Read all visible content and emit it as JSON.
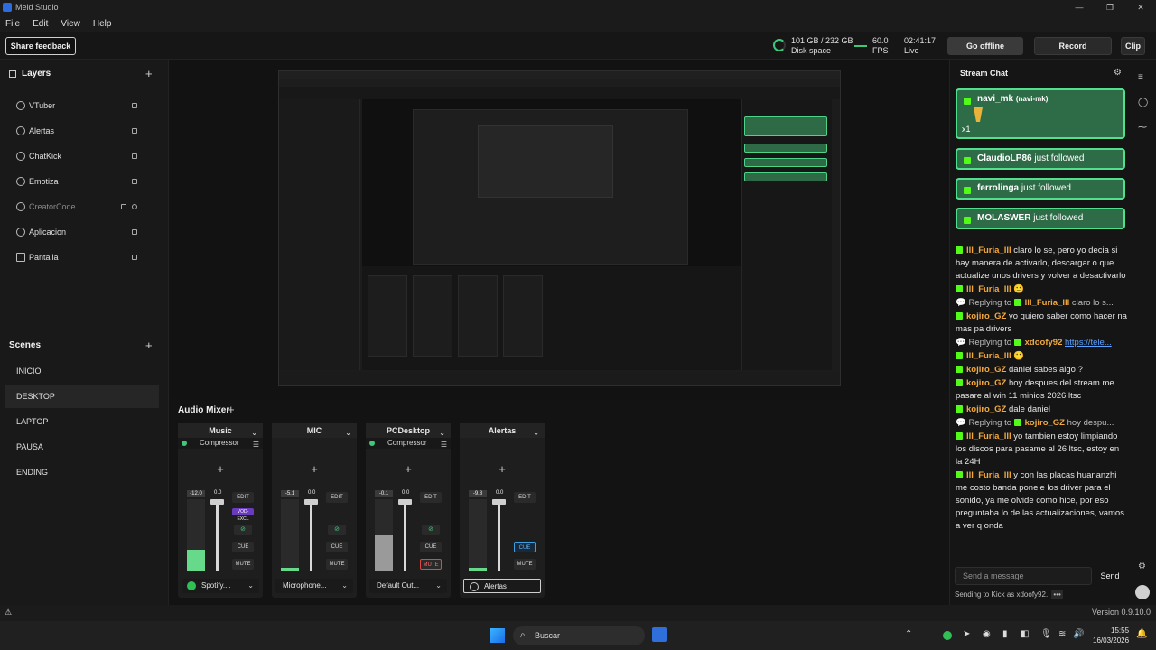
{
  "window": {
    "title": "Meld Studio",
    "buttons": [
      "—",
      "❐",
      "✕"
    ]
  },
  "menu": [
    "File",
    "Edit",
    "View",
    "Help"
  ],
  "toolbar": {
    "share_feedback": "Share feedback",
    "disk_value": "101 GB / 232 GB",
    "disk_label": "Disk space",
    "fps_value": "60.0",
    "fps_label": "FPS",
    "live_time": "02:41:17",
    "live_label": "Live",
    "go_offline": "Go offline",
    "record": "Record",
    "clip": "Clip"
  },
  "layers": {
    "title": "Layers",
    "items": [
      {
        "label": "VTuber",
        "dim": false
      },
      {
        "label": "Alertas",
        "dim": false
      },
      {
        "label": "ChatKick",
        "dim": false
      },
      {
        "label": "Emotiza",
        "dim": false
      },
      {
        "label": "CreatorCode",
        "dim": true
      },
      {
        "label": "Aplicacion",
        "dim": false
      },
      {
        "label": "Pantalla",
        "dim": false
      }
    ]
  },
  "scenes": {
    "title": "Scenes",
    "items": [
      "INICIO",
      "DESKTOP",
      "LAPTOP",
      "PAUSA",
      "ENDING"
    ],
    "active": "DESKTOP"
  },
  "mixer": {
    "title": "Audio Mixer",
    "strips": [
      {
        "name": "Music",
        "fx": "Compressor",
        "db": "-12.0",
        "gain": "0.0",
        "source": "Spotify....",
        "tag": "VOD-EXCL",
        "mute_state": "normal",
        "cue_state": "normal",
        "meter": 0.3,
        "meter_color": "#66d98a"
      },
      {
        "name": "MIC",
        "fx": "",
        "db": "-5.1",
        "gain": "0.0",
        "source": "Microphone...",
        "tag": "",
        "mute_state": "normal",
        "cue_state": "normal",
        "meter": 0.05,
        "meter_color": "#66d98a"
      },
      {
        "name": "PCDesktop",
        "fx": "Compressor",
        "db": "-0.1",
        "gain": "0.0",
        "source": "Default Out...",
        "tag": "",
        "mute_state": "red",
        "cue_state": "normal",
        "meter": 0.5,
        "meter_color": "#9a9a9a"
      },
      {
        "name": "Alertas",
        "fx": "",
        "db": "-9.8",
        "gain": "0.0",
        "source": "Alertas",
        "tag": "",
        "mute_state": "normal",
        "cue_state": "blue",
        "meter": 0.05,
        "meter_color": "#66d98a"
      }
    ],
    "labels": {
      "edit": "EDIT",
      "cue": "CUE",
      "mute": "MUTE",
      "link": "⊘"
    }
  },
  "chat": {
    "title": "Stream Chat",
    "highlight": {
      "user": "navi_mk",
      "handle": "(navi-mk)",
      "count": "x1"
    },
    "follows": [
      {
        "user": "ClaudioLP86",
        "text": "just followed"
      },
      {
        "user": "ferrolinga",
        "text": "just followed"
      },
      {
        "user": "MOLASWER",
        "text": "just followed"
      }
    ],
    "messages": [
      {
        "type": "msg",
        "user": "lll_Furia_lll",
        "text": "claro lo se, pero yo decia si hay manera de activarlo, descargar o que actualize unos drivers y volver a desactivarlo"
      },
      {
        "type": "msg",
        "user": "lll_Furia_lll",
        "text": "🙂"
      },
      {
        "type": "reply",
        "prefix": "Replying to",
        "user": "lll_Furia_lll",
        "text": "claro lo s..."
      },
      {
        "type": "msg",
        "user": "kojiro_GZ",
        "text": "yo quiero saber como hacer na mas pa drivers"
      },
      {
        "type": "reply",
        "prefix": "Replying to",
        "user": "xdoofy92",
        "text": "https://tele...",
        "link": true
      },
      {
        "type": "msg",
        "user": "lll_Furia_lll",
        "text": "🙂"
      },
      {
        "type": "msg",
        "user": "kojiro_GZ",
        "text": "daniel sabes algo ?"
      },
      {
        "type": "msg",
        "user": "kojiro_GZ",
        "text": "hoy despues del stream me pasare al win 11 minios 2026 ltsc"
      },
      {
        "type": "msg",
        "user": "kojiro_GZ",
        "text": "dale daniel"
      },
      {
        "type": "reply",
        "prefix": "Replying to",
        "user": "kojiro_GZ",
        "text": "hoy despu..."
      },
      {
        "type": "msg",
        "user": "lll_Furia_lll",
        "text": "yo tambien estoy limpiando los discos para pasame al 26 ltsc, estoy en la 24H"
      },
      {
        "type": "msg",
        "user": "lll_Furia_lll",
        "text": "y con las placas huananzhi me costo banda ponele los driver para el sonido, ya me olvide como hice, por eso preguntaba lo de las actualizaciones, vamos a ver q onda"
      }
    ],
    "input_placeholder": "Send a message",
    "send": "Send",
    "sending_as": "Sending to Kick as xdoofy92.",
    "more": "•••"
  },
  "status": {
    "version": "Version 0.9.10.0",
    "warn_icon": "⚠"
  },
  "taskbar": {
    "search": "Buscar",
    "time": "15:55",
    "date": "16/03/2026"
  }
}
